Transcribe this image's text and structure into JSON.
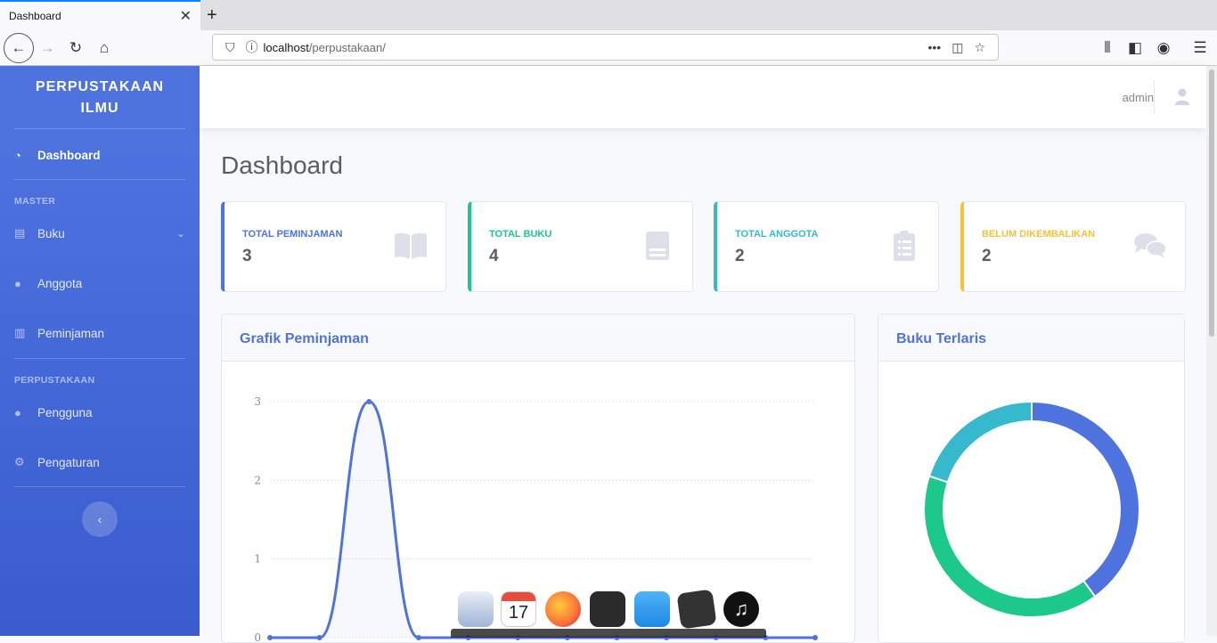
{
  "browser": {
    "tab_title": "Dashboard",
    "url_host": "localhost",
    "url_path": "/perpustakaan/"
  },
  "sidebar": {
    "brand": "PERPUSTAKAAN ILMU",
    "dashboard_label": "Dashboard",
    "section_master": "MASTER",
    "buku_label": "Buku",
    "anggota_label": "Anggota",
    "peminjaman_label": "Peminjaman",
    "section_perpustakaan": "PERPUSTAKAAN",
    "pengguna_label": "Pengguna",
    "pengaturan_label": "Pengaturan"
  },
  "topbar": {
    "user_name": "admin"
  },
  "page_title": "Dashboard",
  "cards": [
    {
      "label": "TOTAL PEMINJAMAN",
      "value": "3",
      "color": "#4e73df",
      "icon": "book-open-icon"
    },
    {
      "label": "TOTAL BUKU",
      "value": "4",
      "color": "#1cc88a",
      "icon": "book-icon"
    },
    {
      "label": "TOTAL ANGGOTA",
      "value": "2",
      "color": "#36b9cc",
      "icon": "clipboard-list-icon"
    },
    {
      "label": "BELUM DIKEMBALIKAN",
      "value": "2",
      "color": "#f6c23e",
      "icon": "comments-icon"
    }
  ],
  "panels": {
    "line_title": "Grafik Peminjaman",
    "donut_title": "Buku Terlaris"
  },
  "chart_data": [
    {
      "type": "area",
      "title": "Grafik Peminjaman",
      "y_ticks": [
        "3",
        "2",
        "1",
        "0"
      ],
      "ylim": [
        0,
        3
      ],
      "values": [
        0,
        0,
        3,
        0,
        0,
        0,
        0,
        0,
        0,
        0,
        0,
        0
      ],
      "color": "#4e73df",
      "grid": true
    },
    {
      "type": "pie",
      "title": "Buku Terlaris",
      "values": [
        2,
        2,
        1
      ],
      "colors": [
        "#4e73df",
        "#1cc88a",
        "#36b9cc"
      ]
    }
  ]
}
